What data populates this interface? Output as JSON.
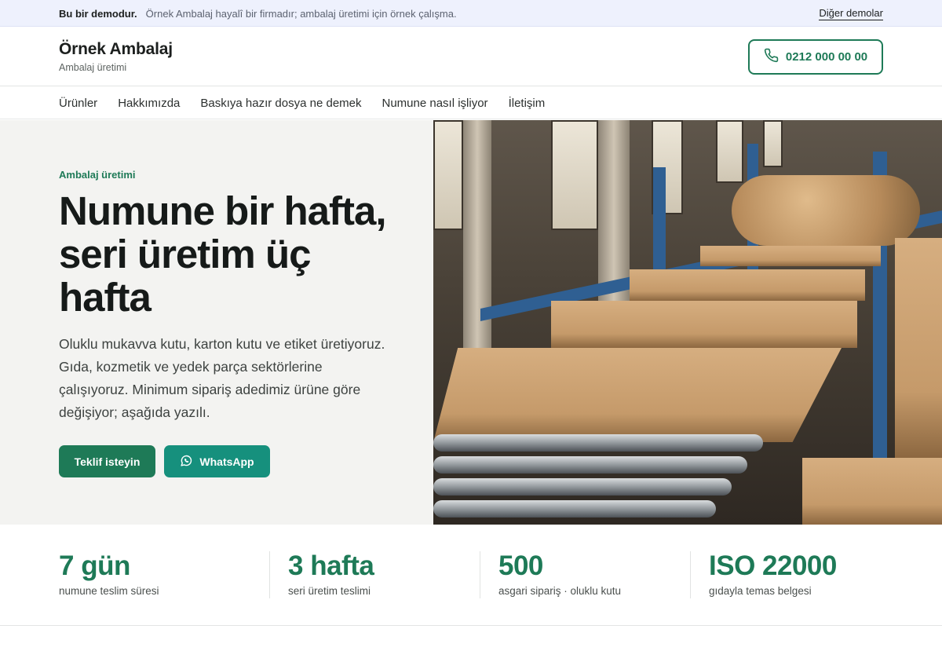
{
  "demo_bar": {
    "strong": "Bu bir demodur.",
    "note": "Örnek Ambalaj hayalî bir firmadır; ambalaj üretimi için örnek çalışma.",
    "other_link": "Diğer demolar"
  },
  "header": {
    "brand_name": "Örnek Ambalaj",
    "brand_sub": "Ambalaj üretimi",
    "phone": "0212 000 00 00",
    "phone_icon": "phone-icon"
  },
  "nav": {
    "items": [
      {
        "label": "Ürünler"
      },
      {
        "label": "Hakkımızda"
      },
      {
        "label": "Baskıya hazır dosya ne demek"
      },
      {
        "label": "Numune nasıl işliyor"
      },
      {
        "label": "İletişim"
      }
    ]
  },
  "hero": {
    "kicker": "Ambalaj üretimi",
    "title": "Numune bir hafta, seri üretim üç hafta",
    "lead": "Oluklu mukavva kutu, karton kutu ve etiket üretiyoruz. Gıda, kozmetik ve yedek parça sektörlerine çalışıyoruz. Minimum sipariş adedimiz ürüne göre değişiyor; aşağıda yazılı.",
    "cta_primary": "Teklif isteyin",
    "cta_whatsapp": "WhatsApp",
    "whatsapp_icon": "whatsapp-icon"
  },
  "stats": [
    {
      "value": "7 gün",
      "label": "numune teslim süresi"
    },
    {
      "value": "3 hafta",
      "label": "seri üretim teslimi"
    },
    {
      "value": "500",
      "label": "asgari sipariş · oluklu kutu"
    },
    {
      "value": "ISO 22000",
      "label": "gıdayla temas belgesi"
    }
  ],
  "colors": {
    "brand_green": "#1e7a57",
    "whatsapp_teal": "#16907d",
    "demo_bar_bg": "#eef1fd",
    "hero_bg": "#f3f3f1"
  }
}
